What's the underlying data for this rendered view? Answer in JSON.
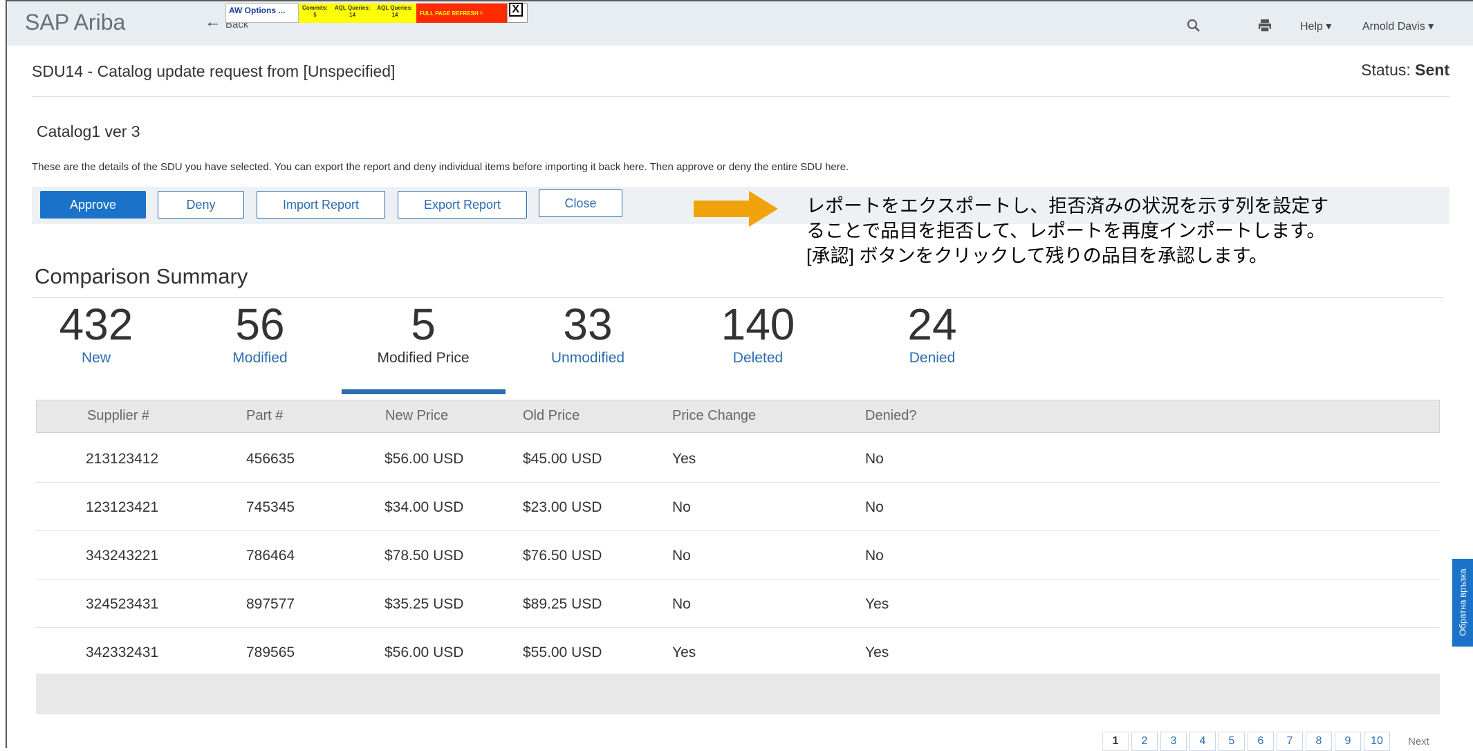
{
  "header": {
    "brand": "SAP Ariba",
    "back_label": "Back",
    "debug": {
      "aw_options": "AW Options ...",
      "cells": [
        {
          "label": "Commits:",
          "value": "5"
        },
        {
          "label": "AQL Queries:",
          "value": "14"
        },
        {
          "label": "AQL Queries:",
          "value": "14"
        }
      ],
      "refresh": "FULL PAGE REFRESH !:",
      "close": "X"
    },
    "help_label": "Help ▾",
    "user_label": "Arnold Davis ▾"
  },
  "page": {
    "title": "SDU14 - Catalog update request from [Unspecified]",
    "status_label": "Status:",
    "status_value": "Sent",
    "catalog_name": "Catalog1 ver 3",
    "description": "These are the details of the SDU you have selected. You can export the report and deny individual items before importing it back here. Then approve or deny the entire SDU here."
  },
  "actions": {
    "approve": "Approve",
    "deny": "Deny",
    "import_report": "Import Report",
    "export_report": "Export Report",
    "close": "Close"
  },
  "callout": {
    "text": "レポートをエクスポートし、拒否済みの状況を示す列を設定することで品目を拒否して、レポートを再度インポートします。[承認] ボタンをクリックして残りの品目を承認します。",
    "arrow_color": "#f0a30a"
  },
  "summary": {
    "title": "Comparison Summary",
    "stats": [
      {
        "value": "432",
        "label": "New"
      },
      {
        "value": "56",
        "label": "Modified"
      },
      {
        "value": "5",
        "label": "Modified Price",
        "active": true
      },
      {
        "value": "33",
        "label": "Unmodified"
      },
      {
        "value": "140",
        "label": "Deleted"
      },
      {
        "value": "24",
        "label": "Denied"
      }
    ]
  },
  "table": {
    "columns": [
      "Supplier #",
      "Part #",
      "New Price",
      "Old Price",
      "Price Change",
      "Denied?"
    ],
    "rows": [
      [
        "213123412",
        "456635",
        "$56.00 USD",
        "$45.00 USD",
        "Yes",
        "No"
      ],
      [
        "123123421",
        "745345",
        "$34.00 USD",
        "$23.00 USD",
        "No",
        "No"
      ],
      [
        "343243221",
        "786464",
        "$78.50 USD",
        "$76.50 USD",
        "No",
        "No"
      ],
      [
        "324523431",
        "897577",
        "$35.25 USD",
        "$89.25 USD",
        "No",
        "Yes"
      ],
      [
        "342332431",
        "789565",
        "$56.00 USD",
        "$55.00 USD",
        "Yes",
        "Yes"
      ]
    ]
  },
  "pagination": {
    "pages": [
      "1",
      "2",
      "3",
      "4",
      "5",
      "6",
      "7",
      "8",
      "9",
      "10"
    ],
    "current": "1",
    "next_label": "Next"
  },
  "feedback_tab": "Обратна връзка",
  "colors": {
    "accent": "#1a73c9",
    "header_bg": "#e8edf2",
    "callout_arrow": "#f0a30a"
  }
}
